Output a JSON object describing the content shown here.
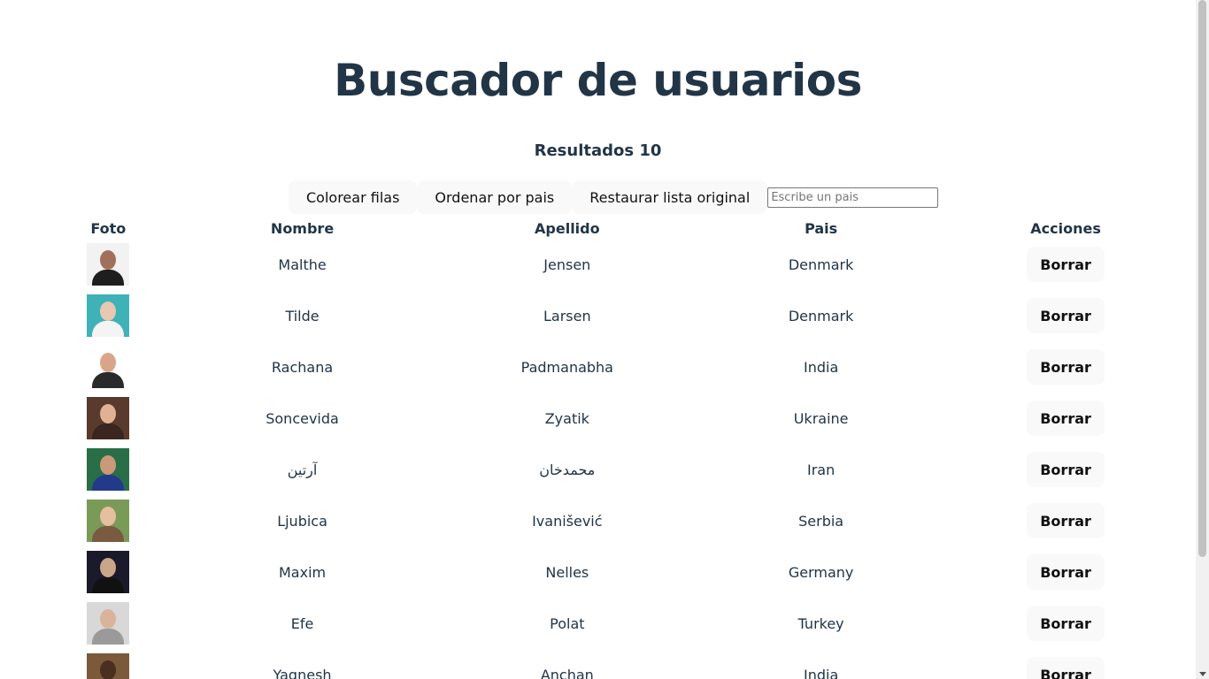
{
  "header": {
    "title": "Buscador de usuarios"
  },
  "results": {
    "label": "Resultados 10"
  },
  "toolbar": {
    "color_rows": "Colorear filas",
    "sort_country": "Ordenar por pais",
    "restore": "Restaurar lista original",
    "filter_placeholder": "Escribe un pais",
    "filter_value": ""
  },
  "table": {
    "headers": {
      "foto": "Foto",
      "nombre": "Nombre",
      "apellido": "Apellido",
      "pais": "Pais",
      "acciones": "Acciones"
    },
    "delete_label": "Borrar",
    "rows": [
      {
        "nombre": "Malthe",
        "apellido": "Jensen",
        "pais": "Denmark",
        "bg": "#f2f2f2",
        "skin": "#a0715a",
        "shirt": "#1e1e1e"
      },
      {
        "nombre": "Tilde",
        "apellido": "Larsen",
        "pais": "Denmark",
        "bg": "#3fb2b8",
        "skin": "#e7c8b2",
        "shirt": "#f4f4f4"
      },
      {
        "nombre": "Rachana",
        "apellido": "Padmanabha",
        "pais": "India",
        "bg": "#ffffff",
        "skin": "#d9a58a",
        "shirt": "#2a2a2a"
      },
      {
        "nombre": "Soncevida",
        "apellido": "Zyatik",
        "pais": "Ukraine",
        "bg": "#5a3a2c",
        "skin": "#e0b293",
        "shirt": "#3a2520"
      },
      {
        "nombre": "آرتین",
        "apellido": "محمدخان",
        "pais": "Iran",
        "bg": "#2a6e48",
        "skin": "#c99978",
        "shirt": "#233a8c"
      },
      {
        "nombre": "Ljubica",
        "apellido": "Ivanišević",
        "pais": "Serbia",
        "bg": "#7a9a58",
        "skin": "#e6bea0",
        "shirt": "#7a5a40"
      },
      {
        "nombre": "Maxim",
        "apellido": "Nelles",
        "pais": "Germany",
        "bg": "#1a1a2a",
        "skin": "#c9a68a",
        "shirt": "#111111"
      },
      {
        "nombre": "Efe",
        "apellido": "Polat",
        "pais": "Turkey",
        "bg": "#d8d8d8",
        "skin": "#d9b49a",
        "shirt": "#9a9a9a"
      },
      {
        "nombre": "Yagnesh",
        "apellido": "Anchan",
        "pais": "India",
        "bg": "#7a5a3a",
        "skin": "#4a2e1e",
        "shirt": "#3a3a3a"
      }
    ]
  }
}
